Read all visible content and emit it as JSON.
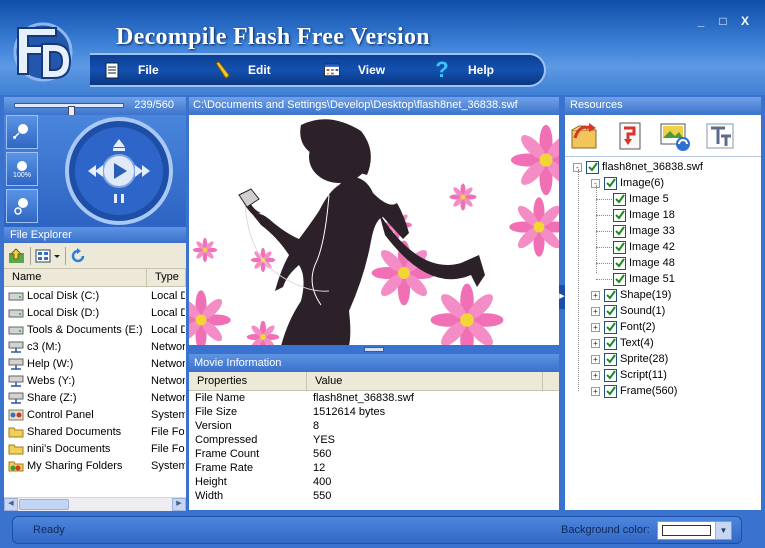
{
  "app": {
    "title": "Decompile Flash  Free Version",
    "window_controls": [
      "_",
      "□",
      "X"
    ]
  },
  "menu": [
    {
      "label": "File",
      "icon": "document-icon"
    },
    {
      "label": "Edit",
      "icon": "pencil-icon"
    },
    {
      "label": "View",
      "icon": "view-grid-icon"
    },
    {
      "label": "Help",
      "icon": "question-icon"
    }
  ],
  "player": {
    "frame_counter": "239/560",
    "timeline_position": 0.43,
    "zoom_buttons": [
      "zoom-in-icon",
      "zoom-100-icon",
      "zoom-out-icon"
    ],
    "zoom_100_label": "100%"
  },
  "file_explorer": {
    "title": "File Explorer",
    "columns": [
      "Name",
      "Type"
    ],
    "rows": [
      {
        "name": "Local Disk (C:)",
        "type": "Local D",
        "icon": "drive-icon"
      },
      {
        "name": "Local Disk (D:)",
        "type": "Local D",
        "icon": "drive-icon"
      },
      {
        "name": "Tools & Documents (E:)",
        "type": "Local D",
        "icon": "drive-icon"
      },
      {
        "name": "c3 (M:)",
        "type": "Networ",
        "icon": "network-drive-icon"
      },
      {
        "name": "Help (W:)",
        "type": "Networ",
        "icon": "network-drive-icon"
      },
      {
        "name": "Webs (Y:)",
        "type": "Networ",
        "icon": "network-drive-icon"
      },
      {
        "name": "Share (Z:)",
        "type": "Networ",
        "icon": "network-drive-icon"
      },
      {
        "name": "Control Panel",
        "type": "System",
        "icon": "control-panel-icon"
      },
      {
        "name": "Shared Documents",
        "type": "File Fol",
        "icon": "folder-icon"
      },
      {
        "name": "nini's Documents",
        "type": "File Fol",
        "icon": "folder-icon"
      },
      {
        "name": "My Sharing Folders",
        "type": "System",
        "icon": "sharing-folder-icon"
      }
    ]
  },
  "preview": {
    "path": "C:\\Documents and Settings\\Develop\\Desktop\\flash8net_36838.swf"
  },
  "movie_info": {
    "title": "Movie Information",
    "columns": [
      "Properties",
      "Value"
    ],
    "rows": [
      {
        "property": "File Name",
        "value": "flash8net_36838.swf"
      },
      {
        "property": "File Size",
        "value": "1512614 bytes"
      },
      {
        "property": "Version",
        "value": "8"
      },
      {
        "property": "Compressed",
        "value": "YES"
      },
      {
        "property": "Frame Count",
        "value": "560"
      },
      {
        "property": "Frame Rate",
        "value": "12"
      },
      {
        "property": "Height",
        "value": "400"
      },
      {
        "property": "Width",
        "value": "550"
      }
    ]
  },
  "resources": {
    "title": "Resources",
    "tools": [
      "open-folder-icon",
      "export-icon",
      "image-refresh-icon",
      "text-tool-icon"
    ],
    "tree": {
      "root": "flash8net_36838.swf",
      "image_group": "Image(6)",
      "images": [
        "Image 5",
        "Image 18",
        "Image 33",
        "Image 42",
        "Image 48",
        "Image 51"
      ],
      "groups": [
        "Shape(19)",
        "Sound(1)",
        "Font(2)",
        "Text(4)",
        "Sprite(28)",
        "Script(11)",
        "Frame(560)"
      ]
    }
  },
  "status": {
    "text": "Ready",
    "background_label": "Background color:",
    "background_color": "#ffffff"
  },
  "colors": {
    "frame_blue": "#3a73cf",
    "title_blue": "#0f4ea9",
    "flower_pink": "#f06fb5",
    "flower_center": "#f3d534"
  }
}
